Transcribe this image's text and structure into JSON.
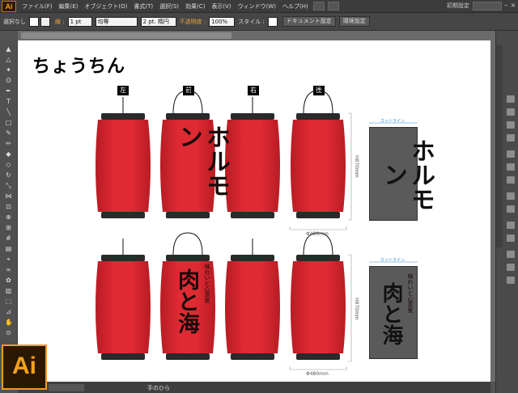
{
  "app": {
    "logo_text": "Ai",
    "menus": [
      "ファイル(F)",
      "編集(E)",
      "オブジェクト(O)",
      "書式(T)",
      "選択(S)",
      "効果(C)",
      "表示(V)",
      "ウィンドウ(W)",
      "ヘルプ(H)"
    ],
    "workspace": "初期設定",
    "window_controls": [
      "–",
      "□",
      "×"
    ]
  },
  "control_bar": {
    "selection": "選択なし",
    "stroke_label": "線 :",
    "stroke_weight": "1 pt",
    "profile": "均等",
    "brush": "2 pt. 楕円",
    "opacity_label": "不透明度 :",
    "opacity": "100%",
    "style_label": "スタイル :",
    "doc_settings": "ドキュメント設定",
    "preferences": "環境設定"
  },
  "canvas": {
    "title": "ちょうちん",
    "view_labels": [
      "左",
      "前",
      "右",
      "後"
    ],
    "row1": {
      "lantern_text": "ホルモン",
      "height_dim": "H870mm",
      "width_dim": "Φ480mm",
      "cutline": "カットライン",
      "panel_text": "ホルモン"
    },
    "row2": {
      "lantern_main": "肉と海",
      "lantern_sub": "味わいと心意気",
      "height_dim": "H870mm",
      "width_dim": "Φ480mm",
      "cutline": "カットライン",
      "panel_main": "肉と海",
      "panel_sub": "味わいと心意気"
    }
  },
  "status": {
    "tool": "手のひら"
  },
  "colors": {
    "lantern_red": "#d8262f",
    "lantern_dark": "#a01820",
    "cap": "#2a2a2a",
    "accent": "#f39a1e",
    "cutline": "#2b8de0"
  }
}
